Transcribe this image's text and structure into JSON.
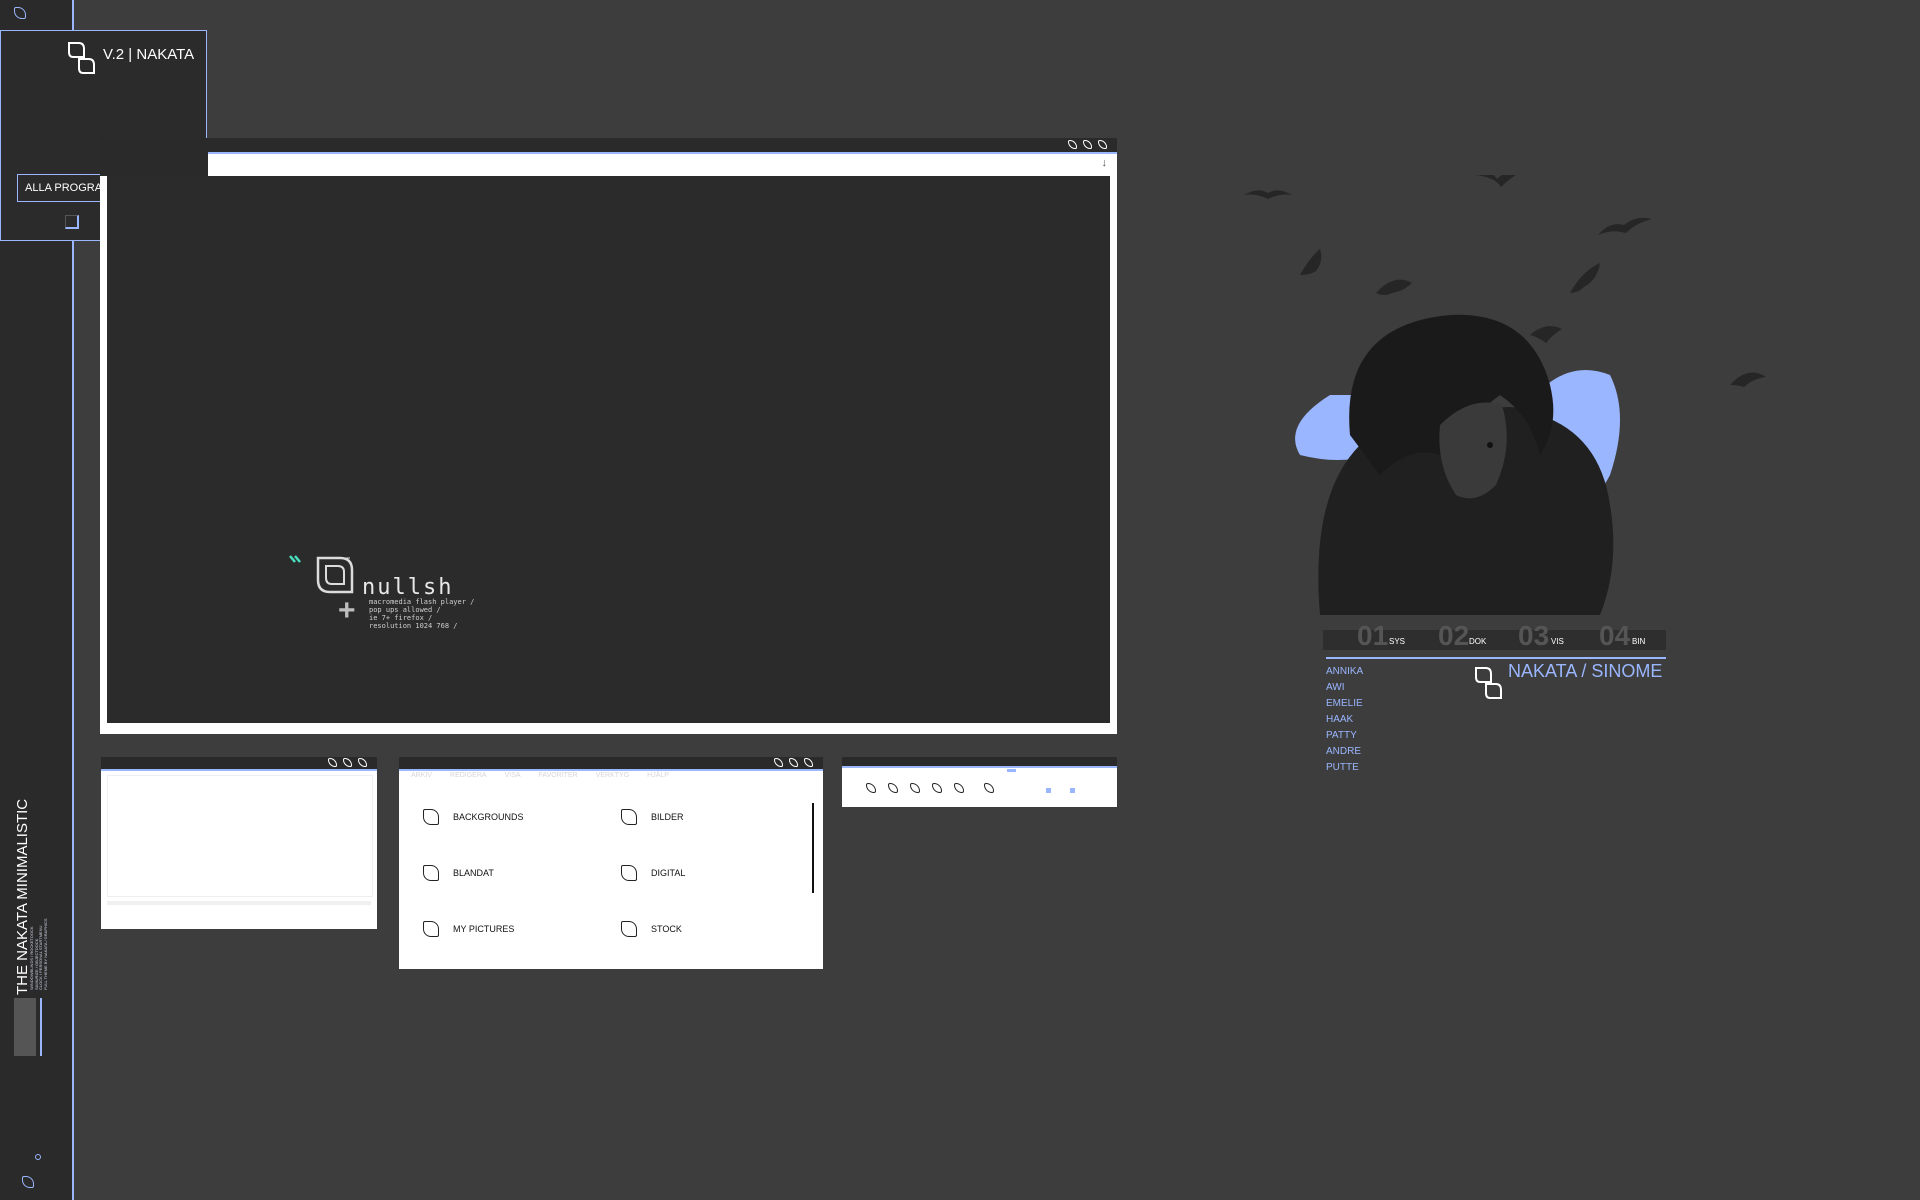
{
  "dock": {
    "vertical_title": "THE NAKATA MINIMALISTIC",
    "vertical_subtitle": "WINDOWBLINDS / ROCKETDOCK\nSAMURIZE / OBJECTDOCK\nCLOCK / PERSONAL STARTMENU\nFULL THEME BY NAKATA / GRAPHICS"
  },
  "start_menu": {
    "title": "V.2 | NAKATA",
    "all_programs_label": "ALLA PROGRAM",
    "all_programs_arrow": "›"
  },
  "main_window": {
    "address_arrow": "↓",
    "splash": {
      "wordmark": "nullsh",
      "lines": "macromedia flash player /\npop ups allowed /\nie 7+ firefox /\nresolution 1024 768 /",
      "plus": "+"
    }
  },
  "folder_window": {
    "tabs": [
      "ARKIV",
      "REDIGERA",
      "VISA",
      "FAVORITER",
      "VERKTYG",
      "HJÄLP"
    ],
    "items": [
      {
        "label": "BACKGROUNDS"
      },
      {
        "label": "BILDER"
      },
      {
        "label": "BLANDAT"
      },
      {
        "label": "DIGITAL"
      },
      {
        "label": "MY PICTURES"
      },
      {
        "label": "STOCK"
      }
    ]
  },
  "character_panel": {
    "tabs": [
      {
        "num": "01",
        "label": "SYS"
      },
      {
        "num": "02",
        "label": "DOK"
      },
      {
        "num": "03",
        "label": "VIS"
      },
      {
        "num": "04",
        "label": "BIN"
      }
    ],
    "users": [
      "ANNIKA",
      "AWI",
      "EMELIE",
      "HAAK",
      "PATTY",
      "ANDRE",
      "PUTTE"
    ],
    "brand": "NAKATA / SINOME"
  },
  "colors": {
    "accent": "#9ab6ff",
    "desktop": "#3d3d3d",
    "panel": "#2a2a2a"
  }
}
